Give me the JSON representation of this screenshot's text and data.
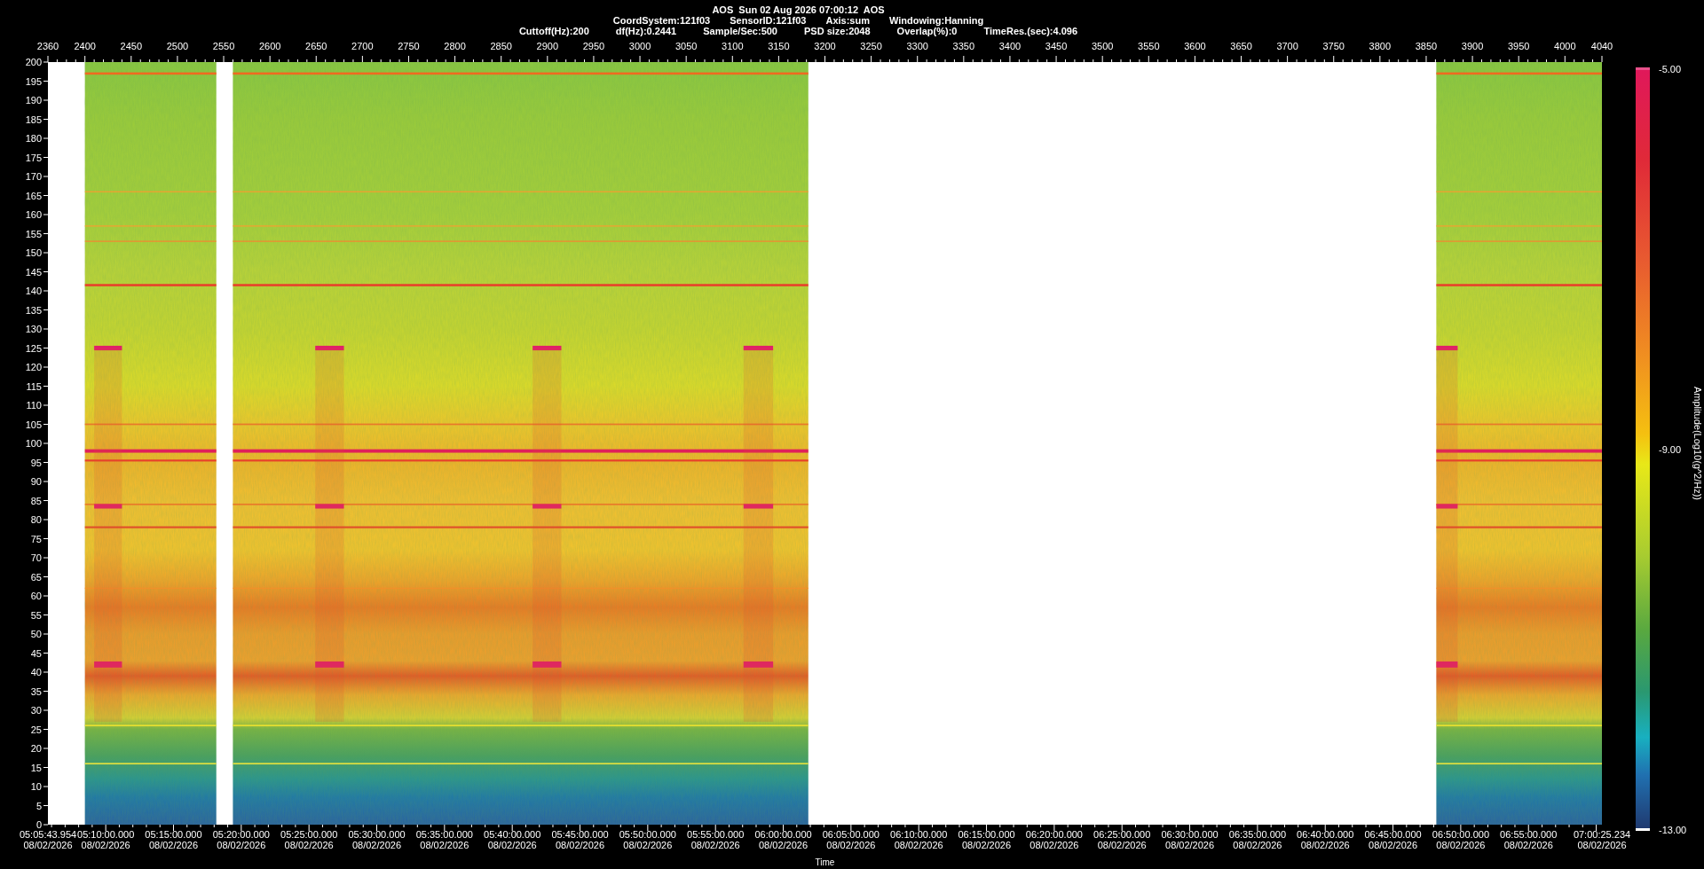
{
  "header": {
    "title": "AOS  Sun 02 Aug 2026 07:00:12  AOS",
    "line_2": [
      "CoordSystem:121f03",
      "SensorID:121f03",
      "Axis:sum",
      "Windowing:Hanning"
    ],
    "line_3": [
      "Cuttoff(Hz):200",
      "df(Hz):0.2441",
      "Sample/Sec:500",
      "PSD size:2048",
      "Overlap(%):0",
      "TimeRes.(sec):4.096"
    ]
  },
  "top_axis": {
    "labels": [
      "2360",
      "2400",
      "2450",
      "2500",
      "2550",
      "2600",
      "2650",
      "2700",
      "2750",
      "2800",
      "2850",
      "2900",
      "2950",
      "3000",
      "3050",
      "3100",
      "3150",
      "3200",
      "3250",
      "3300",
      "3350",
      "3400",
      "3450",
      "3500",
      "3550",
      "3600",
      "3650",
      "3700",
      "3750",
      "3800",
      "3850",
      "3900",
      "3950",
      "4000",
      "4040"
    ]
  },
  "left_axis": {
    "labels": [
      "200",
      "195",
      "190",
      "185",
      "180",
      "175",
      "170",
      "165",
      "160",
      "155",
      "150",
      "145",
      "140",
      "135",
      "130",
      "125",
      "120",
      "115",
      "110",
      "105",
      "100",
      "95",
      "90",
      "85",
      "80",
      "75",
      "70",
      "65",
      "60",
      "55",
      "50",
      "45",
      "40",
      "35",
      "30",
      "25",
      "20",
      "15",
      "10",
      "5",
      "0"
    ]
  },
  "bottom_axis": {
    "title": "Time",
    "labels": [
      {
        "time": "05:05:43.954",
        "date": "08/02/2026"
      },
      {
        "time": "05:10:00.000",
        "date": "08/02/2026"
      },
      {
        "time": "05:15:00.000",
        "date": "08/02/2026"
      },
      {
        "time": "05:20:00.000",
        "date": "08/02/2026"
      },
      {
        "time": "05:25:00.000",
        "date": "08/02/2026"
      },
      {
        "time": "05:30:00.000",
        "date": "08/02/2026"
      },
      {
        "time": "05:35:00.000",
        "date": "08/02/2026"
      },
      {
        "time": "05:40:00.000",
        "date": "08/02/2026"
      },
      {
        "time": "05:45:00.000",
        "date": "08/02/2026"
      },
      {
        "time": "05:50:00.000",
        "date": "08/02/2026"
      },
      {
        "time": "05:55:00.000",
        "date": "08/02/2026"
      },
      {
        "time": "06:00:00.000",
        "date": "08/02/2026"
      },
      {
        "time": "06:05:00.000",
        "date": "08/02/2026"
      },
      {
        "time": "06:10:00.000",
        "date": "08/02/2026"
      },
      {
        "time": "06:15:00.000",
        "date": "08/02/2026"
      },
      {
        "time": "06:20:00.000",
        "date": "08/02/2026"
      },
      {
        "time": "06:25:00.000",
        "date": "08/02/2026"
      },
      {
        "time": "06:30:00.000",
        "date": "08/02/2026"
      },
      {
        "time": "06:35:00.000",
        "date": "08/02/2026"
      },
      {
        "time": "06:40:00.000",
        "date": "08/02/2026"
      },
      {
        "time": "06:45:00.000",
        "date": "08/02/2026"
      },
      {
        "time": "06:50:00.000",
        "date": "08/02/2026"
      },
      {
        "time": "06:55:00.000",
        "date": "08/02/2026"
      },
      {
        "time": "07:00:25.234",
        "date": "08/02/2026"
      }
    ]
  },
  "colorbar": {
    "title": "Amplitude(Log10(g^2/Hz))",
    "max": "-5.00",
    "mid": "-9.00",
    "min": "-13.00"
  }
}
